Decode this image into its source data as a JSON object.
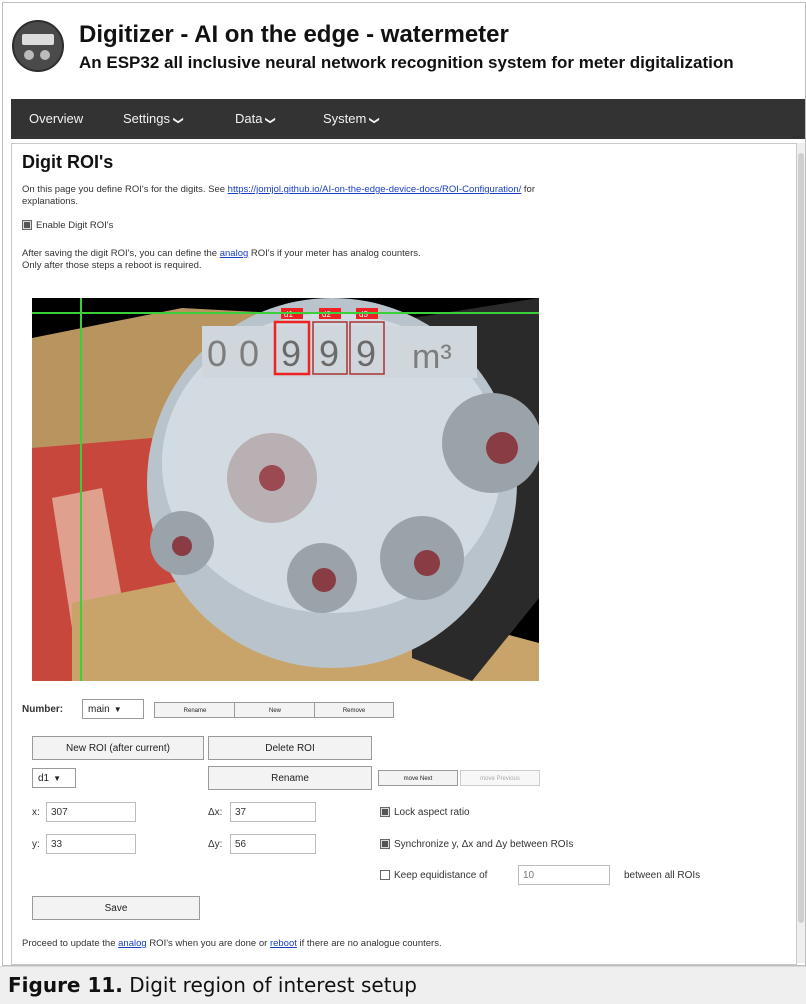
{
  "header": {
    "title": "Digitizer - AI on the edge - watermeter",
    "subtitle": "An ESP32 all inclusive neural network recognition system for meter digitalization"
  },
  "nav": {
    "items": [
      {
        "label": "Overview",
        "chevron": ""
      },
      {
        "label": "Settings",
        "chevron": "❯"
      },
      {
        "label": "Data",
        "chevron": "❯"
      },
      {
        "label": "System",
        "chevron": "❯"
      }
    ]
  },
  "page": {
    "heading": "Digit ROI's",
    "intro_text": "On this page you define ROI's for the digits. See",
    "intro_link": "https://jomjol.github.io/AI-on-the-edge-device-docs/ROI-Configuration/",
    "intro_after": "for",
    "intro_line2": "explanations.",
    "enable_label": "Enable Digit ROI's",
    "enable_checked": true,
    "after_text1": "After saving the digit ROI's, you can define the",
    "after_link": "analog",
    "after_text2": "ROI's if your meter has analog counters.",
    "after_line2": "Only after those steps a reboot is required."
  },
  "image": {
    "roi_labels": [
      "d1",
      "d2",
      "d3"
    ],
    "digits_gray": [
      "0",
      "0"
    ],
    "digits_boxed": [
      "9",
      "9",
      "9"
    ],
    "unit": "m³"
  },
  "number": {
    "label": "Number:",
    "selected": "main",
    "rename_label": "Rename",
    "new_label": "New",
    "remove_label": "Remove"
  },
  "roi": {
    "new_roi_label": "New ROI (after current)",
    "delete_roi_label": "Delete ROI",
    "selected": "d1",
    "rename_label": "Rename",
    "move_next_label": "move Next",
    "move_prev_label": "move Previous",
    "x_label": "x:",
    "x_value": "307",
    "dx_label": "Δx:",
    "dx_value": "37",
    "y_label": "y:",
    "y_value": "33",
    "dy_label": "Δy:",
    "dy_value": "56",
    "lock_label": "Lock aspect ratio",
    "lock_checked": true,
    "sync_label": "Synchronize y, Δx and Δy between ROIs",
    "sync_checked": true,
    "equi_label": "Keep equidistance of",
    "equi_value": "10",
    "equi_after": "between all ROIs",
    "equi_checked": false
  },
  "save": {
    "label": "Save"
  },
  "proceed": {
    "text1": "Proceed to update the",
    "analog_link": "analog",
    "text2": "ROI's when you are done or",
    "reboot_link": "reboot",
    "text3": "if there are no analogue counters."
  },
  "caption": {
    "figure_label": "Figure 11.",
    "text": "Digit region of interest setup"
  }
}
